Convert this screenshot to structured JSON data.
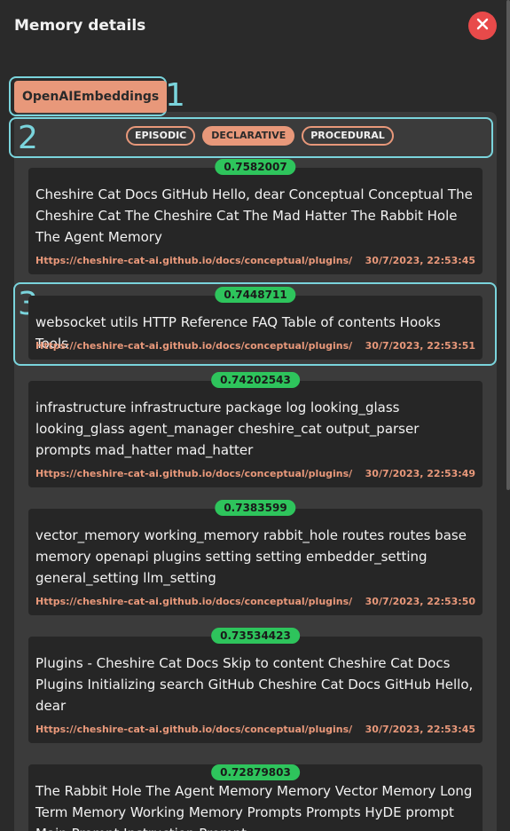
{
  "header": {
    "title": "Memory details"
  },
  "embedder": {
    "label": "OpenAIEmbeddings"
  },
  "filters": [
    {
      "label": "EPISODIC",
      "active": false
    },
    {
      "label": "DECLARATIVE",
      "active": true
    },
    {
      "label": "PROCEDURAL",
      "active": false
    }
  ],
  "annotations": [
    "1",
    "2",
    "3"
  ],
  "memories": [
    {
      "score": "0.7582007",
      "text": "Cheshire Cat Docs GitHub Hello, dear Conceptual Conceptual The Cheshire Cat The Cheshire Cat The Mad Hatter The Rabbit Hole The Agent Memory",
      "source": "Https://cheshire-cat-ai.github.io/docs/conceptual/plugins/",
      "time": "30/7/2023, 22:53:45"
    },
    {
      "score": "0.7448711",
      "text": "websocket utils HTTP Reference FAQ Table of contents Hooks Tools",
      "source": "Https://cheshire-cat-ai.github.io/docs/conceptual/plugins/",
      "time": "30/7/2023, 22:53:51"
    },
    {
      "score": "0.74202543",
      "text": "infrastructure infrastructure package log looking_glass looking_glass agent_manager cheshire_cat output_parser prompts mad_hatter mad_hatter",
      "source": "Https://cheshire-cat-ai.github.io/docs/conceptual/plugins/",
      "time": "30/7/2023, 22:53:49"
    },
    {
      "score": "0.7383599",
      "text": "vector_memory working_memory rabbit_hole routes routes base memory openapi plugins setting setting embedder_setting general_setting llm_setting",
      "source": "Https://cheshire-cat-ai.github.io/docs/conceptual/plugins/",
      "time": "30/7/2023, 22:53:50"
    },
    {
      "score": "0.73534423",
      "text": "Plugins - Cheshire Cat Docs Skip to content Cheshire Cat Docs Plugins Initializing search GitHub Cheshire Cat Docs GitHub Hello, dear",
      "source": "Https://cheshire-cat-ai.github.io/docs/conceptual/plugins/",
      "time": "30/7/2023, 22:53:45"
    },
    {
      "score": "0.72879803",
      "text": "The Rabbit Hole The Agent Memory Memory Vector Memory Long Term Memory Working Memory Prompts Prompts HyDE prompt Main Prompt Instruction Prompt",
      "source": "",
      "time": ""
    }
  ],
  "colors": {
    "accent": "#e8987a",
    "score": "#2ec45c",
    "close": "#e84a4a",
    "highlight": "#7ad4dc"
  }
}
